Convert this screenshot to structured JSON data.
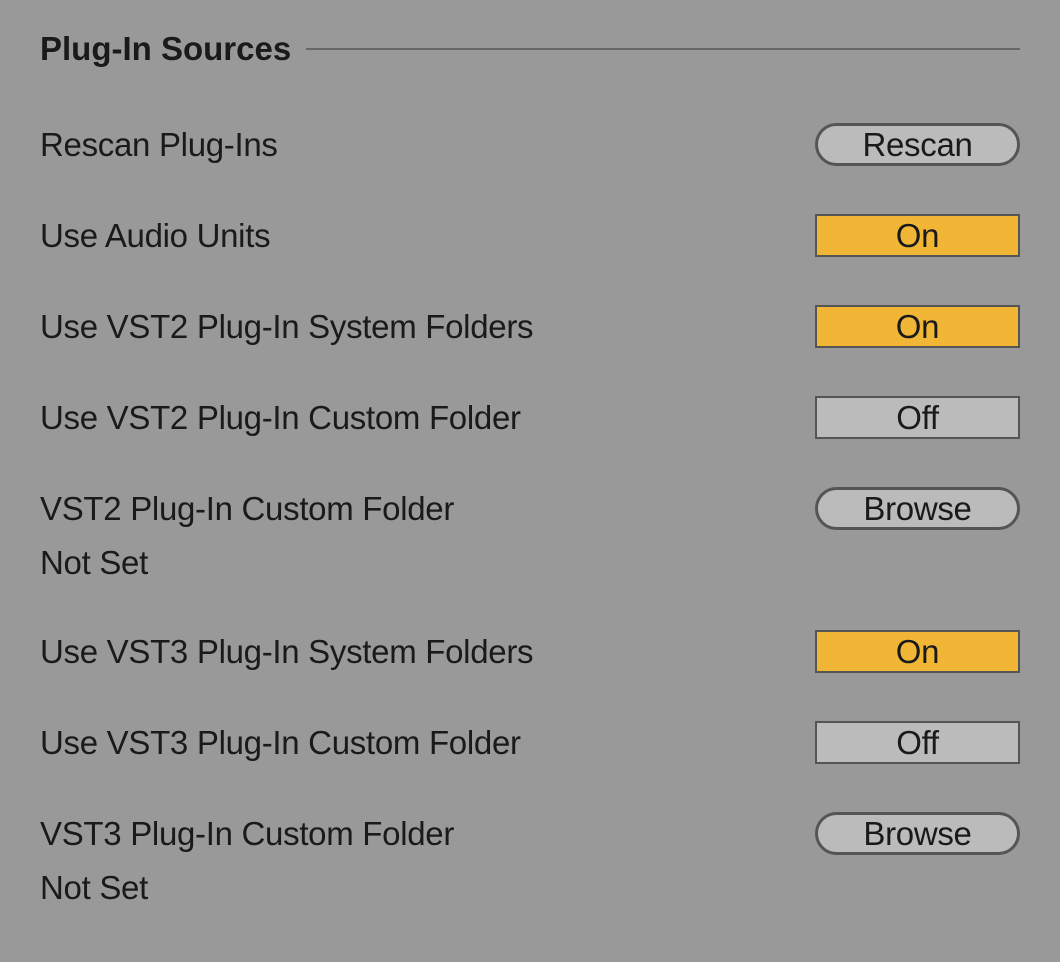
{
  "section": {
    "title": "Plug-In Sources"
  },
  "rows": {
    "rescan": {
      "label": "Rescan Plug-Ins",
      "button": "Rescan"
    },
    "audioUnits": {
      "label": "Use Audio Units",
      "toggle": "On"
    },
    "vst2System": {
      "label": "Use VST2 Plug-In System Folders",
      "toggle": "On"
    },
    "vst2Custom": {
      "label": "Use VST2 Plug-In Custom Folder",
      "toggle": "Off"
    },
    "vst2Folder": {
      "label": "VST2 Plug-In Custom Folder",
      "button": "Browse",
      "path": "Not Set"
    },
    "vst3System": {
      "label": "Use VST3 Plug-In System Folders",
      "toggle": "On"
    },
    "vst3Custom": {
      "label": "Use VST3 Plug-In Custom Folder",
      "toggle": "Off"
    },
    "vst3Folder": {
      "label": "VST3 Plug-In Custom Folder",
      "button": "Browse",
      "path": "Not Set"
    }
  }
}
